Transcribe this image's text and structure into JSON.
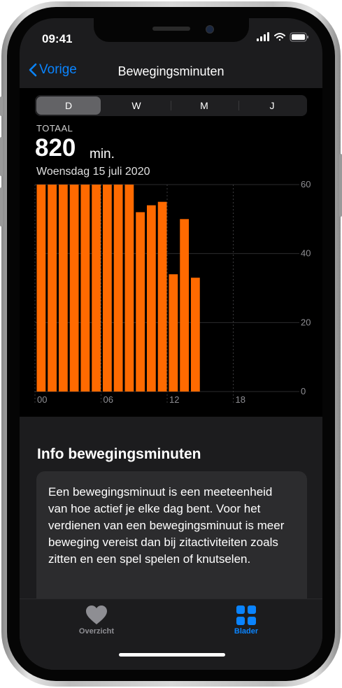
{
  "status_bar": {
    "time": "09:41"
  },
  "nav": {
    "back_label": "Vorige",
    "title": "Bewegingsminuten"
  },
  "segments": [
    "D",
    "W",
    "M",
    "J"
  ],
  "selected_segment": "D",
  "summary": {
    "label": "TOTAAL",
    "value": "820",
    "unit": "min.",
    "date": "Woensdag 15 juli 2020"
  },
  "chart_data": {
    "type": "bar",
    "x": [
      0,
      1,
      2,
      3,
      4,
      5,
      6,
      7,
      8,
      9,
      10,
      11,
      12,
      13,
      14
    ],
    "values": [
      60,
      60,
      60,
      60,
      60,
      60,
      60,
      60,
      60,
      52,
      54,
      55,
      34,
      50,
      33
    ],
    "x_tick_labels": [
      "00",
      "06",
      "12",
      "18"
    ],
    "y_tick_labels": [
      "0",
      "20",
      "40",
      "60"
    ],
    "xlim": [
      0,
      24
    ],
    "ylim": [
      0,
      60
    ],
    "bar_color": "#ff6a00",
    "grid": true
  },
  "info": {
    "title": "Info bewegingsminuten",
    "text": "Een bewegingsminuut is een meeteenheid van hoe actief je elke dag bent. Voor het verdienen van een bewegingsminuut is meer beweging vereist dan bij zitactiviteiten zoals zitten en een spel spelen of knutselen."
  },
  "tabbar": {
    "items": [
      {
        "label": "Overzicht",
        "icon": "heart-icon",
        "active": false
      },
      {
        "label": "Blader",
        "icon": "grid-icon",
        "active": true
      }
    ]
  },
  "colors": {
    "accent": "#0a84ff",
    "bar": "#ff6a00"
  }
}
